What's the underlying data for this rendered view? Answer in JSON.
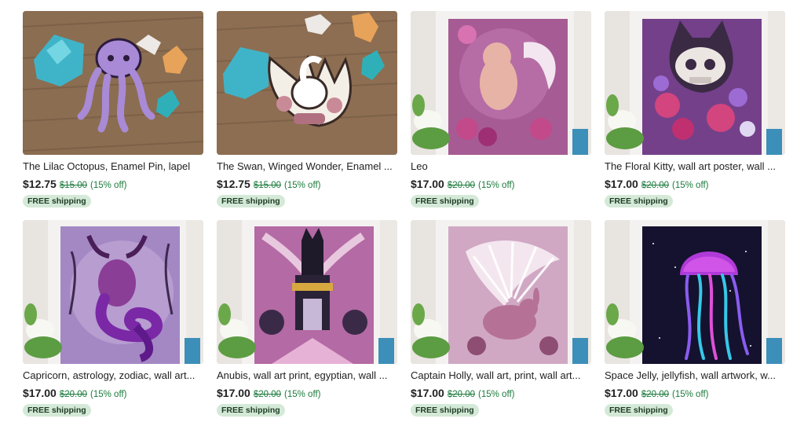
{
  "listings": [
    {
      "title": "The Lilac Octopus, Enamel Pin, lapel",
      "price": "$12.75",
      "original_price": "$15.00",
      "discount": "(15% off)",
      "shipping": "FREE shipping",
      "image_subject": "purple-octopus-enamel-pin-with-crystals"
    },
    {
      "title": "The Swan, Winged Wonder, Enamel ...",
      "price": "$12.75",
      "original_price": "$15.00",
      "discount": "(15% off)",
      "shipping": "FREE shipping",
      "image_subject": "swan-enamel-pin-with-crystals"
    },
    {
      "title": "Leo",
      "price": "$17.00",
      "original_price": "$20.00",
      "discount": "(15% off)",
      "shipping": "FREE shipping",
      "image_subject": "winged-lion-art-print-framed"
    },
    {
      "title": "The Floral Kitty, wall art poster, wall ...",
      "price": "$17.00",
      "original_price": "$20.00",
      "discount": "(15% off)",
      "shipping": "FREE shipping",
      "image_subject": "cat-skull-with-flowers-art-print-framed"
    },
    {
      "title": "Capricorn, astrology, zodiac, wall art...",
      "price": "$17.00",
      "original_price": "$20.00",
      "discount": "(15% off)",
      "shipping": "FREE shipping",
      "image_subject": "capricorn-creature-art-print-framed"
    },
    {
      "title": "Anubis, wall art print, egyptian, wall ...",
      "price": "$17.00",
      "original_price": "$20.00",
      "discount": "(15% off)",
      "shipping": "FREE shipping",
      "image_subject": "anubis-art-print-framed"
    },
    {
      "title": "Captain Holly, wall art, print, wall art...",
      "price": "$17.00",
      "original_price": "$20.00",
      "discount": "(15% off)",
      "shipping": "FREE shipping",
      "image_subject": "winged-rabbit-art-print-framed"
    },
    {
      "title": "Space Jelly, jellyfish, wall artwork, w...",
      "price": "$17.00",
      "original_price": "$20.00",
      "discount": "(15% off)",
      "shipping": "FREE shipping",
      "image_subject": "glowing-jellyfish-art-print-framed"
    }
  ],
  "colors": {
    "price_text": "#222222",
    "sale_text": "#1b7a3c",
    "shipping_badge_bg": "#d4e9d7",
    "shipping_badge_text": "#1d3b25"
  }
}
